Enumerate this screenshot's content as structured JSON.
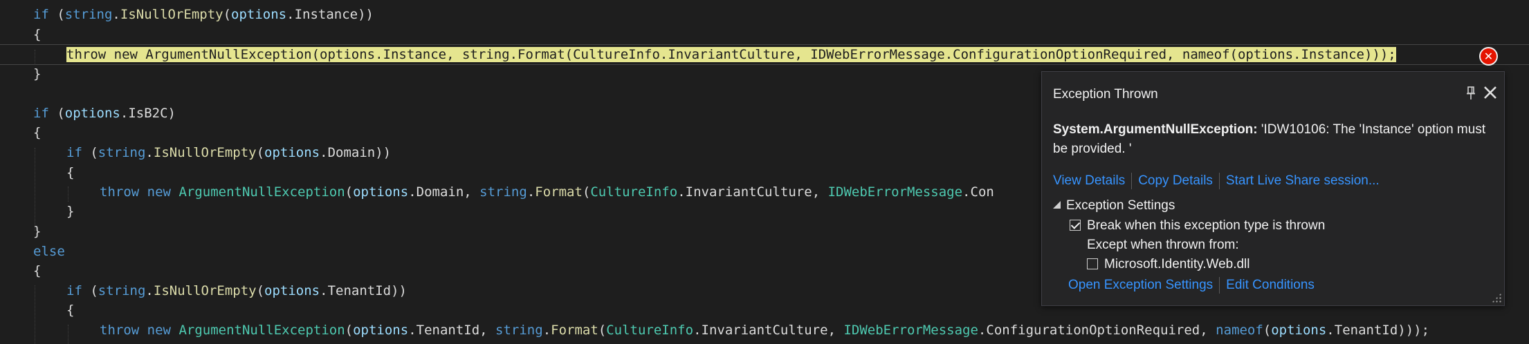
{
  "code_lines": [
    [
      {
        "t": "if",
        "c": "kw"
      },
      {
        "t": " (",
        "c": "pl"
      },
      {
        "t": "string",
        "c": "kw"
      },
      {
        "t": ".",
        "c": "pl"
      },
      {
        "t": "IsNullOrEmpty",
        "c": "mt"
      },
      {
        "t": "(",
        "c": "pl"
      },
      {
        "t": "options",
        "c": "id"
      },
      {
        "t": ".",
        "c": "pl"
      },
      {
        "t": "Instance",
        "c": "pl"
      },
      {
        "t": "))",
        "c": "pl"
      }
    ],
    [
      {
        "t": "{",
        "c": "pl"
      }
    ],
    [
      {
        "t": "throw new ArgumentNullException(options.Instance, string.Format(CultureInfo.InvariantCulture, IDWebErrorMessage.ConfigurationOptionRequired, nameof(options.Instance)));",
        "c": "hl"
      }
    ],
    [
      {
        "t": "}",
        "c": "pl"
      }
    ],
    [],
    [
      {
        "t": "if",
        "c": "kw"
      },
      {
        "t": " (",
        "c": "pl"
      },
      {
        "t": "options",
        "c": "id"
      },
      {
        "t": ".",
        "c": "pl"
      },
      {
        "t": "IsB2C",
        "c": "pl"
      },
      {
        "t": ")",
        "c": "pl"
      }
    ],
    [
      {
        "t": "{",
        "c": "pl"
      }
    ],
    [
      {
        "t": "if",
        "c": "kw"
      },
      {
        "t": " (",
        "c": "pl"
      },
      {
        "t": "string",
        "c": "kw"
      },
      {
        "t": ".",
        "c": "pl"
      },
      {
        "t": "IsNullOrEmpty",
        "c": "mt"
      },
      {
        "t": "(",
        "c": "pl"
      },
      {
        "t": "options",
        "c": "id"
      },
      {
        "t": ".",
        "c": "pl"
      },
      {
        "t": "Domain",
        "c": "pl"
      },
      {
        "t": "))",
        "c": "pl"
      }
    ],
    [
      {
        "t": "{",
        "c": "pl"
      }
    ],
    [
      {
        "t": "throw",
        "c": "kw"
      },
      {
        "t": " ",
        "c": "pl"
      },
      {
        "t": "new",
        "c": "kw"
      },
      {
        "t": " ",
        "c": "pl"
      },
      {
        "t": "ArgumentNullException",
        "c": "ty"
      },
      {
        "t": "(",
        "c": "pl"
      },
      {
        "t": "options",
        "c": "id"
      },
      {
        "t": ".",
        "c": "pl"
      },
      {
        "t": "Domain",
        "c": "pl"
      },
      {
        "t": ", ",
        "c": "pl"
      },
      {
        "t": "string",
        "c": "kw"
      },
      {
        "t": ".",
        "c": "pl"
      },
      {
        "t": "Format",
        "c": "mt"
      },
      {
        "t": "(",
        "c": "pl"
      },
      {
        "t": "CultureInfo",
        "c": "ty"
      },
      {
        "t": ".",
        "c": "pl"
      },
      {
        "t": "InvariantCulture",
        "c": "pl"
      },
      {
        "t": ", ",
        "c": "pl"
      },
      {
        "t": "IDWebErrorMessage",
        "c": "ty"
      },
      {
        "t": ".",
        "c": "pl"
      },
      {
        "t": "Con",
        "c": "pl"
      }
    ],
    [
      {
        "t": "}",
        "c": "pl"
      }
    ],
    [
      {
        "t": "}",
        "c": "pl"
      }
    ],
    [
      {
        "t": "else",
        "c": "kw"
      }
    ],
    [
      {
        "t": "{",
        "c": "pl"
      }
    ],
    [
      {
        "t": "if",
        "c": "kw"
      },
      {
        "t": " (",
        "c": "pl"
      },
      {
        "t": "string",
        "c": "kw"
      },
      {
        "t": ".",
        "c": "pl"
      },
      {
        "t": "IsNullOrEmpty",
        "c": "mt"
      },
      {
        "t": "(",
        "c": "pl"
      },
      {
        "t": "options",
        "c": "id"
      },
      {
        "t": ".",
        "c": "pl"
      },
      {
        "t": "TenantId",
        "c": "pl"
      },
      {
        "t": "))",
        "c": "pl"
      }
    ],
    [
      {
        "t": "{",
        "c": "pl"
      }
    ],
    [
      {
        "t": "throw",
        "c": "kw"
      },
      {
        "t": " ",
        "c": "pl"
      },
      {
        "t": "new",
        "c": "kw"
      },
      {
        "t": " ",
        "c": "pl"
      },
      {
        "t": "ArgumentNullException",
        "c": "ty"
      },
      {
        "t": "(",
        "c": "pl"
      },
      {
        "t": "options",
        "c": "id"
      },
      {
        "t": ".",
        "c": "pl"
      },
      {
        "t": "TenantId",
        "c": "pl"
      },
      {
        "t": ", ",
        "c": "pl"
      },
      {
        "t": "string",
        "c": "kw"
      },
      {
        "t": ".",
        "c": "pl"
      },
      {
        "t": "Format",
        "c": "mt"
      },
      {
        "t": "(",
        "c": "pl"
      },
      {
        "t": "CultureInfo",
        "c": "ty"
      },
      {
        "t": ".",
        "c": "pl"
      },
      {
        "t": "InvariantCulture",
        "c": "pl"
      },
      {
        "t": ", ",
        "c": "pl"
      },
      {
        "t": "IDWebErrorMessage",
        "c": "ty"
      },
      {
        "t": ".",
        "c": "pl"
      },
      {
        "t": "ConfigurationOptionRequired",
        "c": "pl"
      },
      {
        "t": ", ",
        "c": "pl"
      },
      {
        "t": "nameof",
        "c": "kw"
      },
      {
        "t": "(",
        "c": "pl"
      },
      {
        "t": "options",
        "c": "id"
      },
      {
        "t": ".",
        "c": "pl"
      },
      {
        "t": "TenantId",
        "c": "pl"
      },
      {
        "t": ")));",
        "c": "pl"
      }
    ]
  ],
  "error_glyph": {
    "icon": "error-circle-icon",
    "symbol": "✕",
    "color": "#e51400"
  },
  "popup": {
    "title": "Exception Thrown",
    "pin_icon": "pin-icon",
    "close_icon": "close-icon",
    "exception_type": "System.ArgumentNullException:",
    "exception_message": " 'IDW10106: The 'Instance' option must be provided. '",
    "links": {
      "view_details": "View Details",
      "copy_details": "Copy Details",
      "live_share": "Start Live Share session..."
    },
    "settings": {
      "header": "Exception Settings",
      "break_label": "Break when this exception type is thrown",
      "break_checked": true,
      "except_label": "Except when thrown from:",
      "module_label": "Microsoft.Identity.Web.dll",
      "module_checked": false
    },
    "bottom_links": {
      "open_settings": "Open Exception Settings",
      "edit_conditions": "Edit Conditions"
    }
  },
  "colors": {
    "background": "#1e1e1e",
    "keyword": "#569cd6",
    "type": "#4ec9b0",
    "identifier": "#9cdcfe",
    "method": "#dcdcaa",
    "highlight": "#e5e58f",
    "link": "#3794ff"
  }
}
